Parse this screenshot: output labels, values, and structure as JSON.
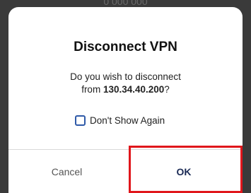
{
  "backdrop": {
    "partial_text": "0 000 000"
  },
  "dialog": {
    "title": "Disconnect VPN",
    "message_line1": "Do you wish to disconnect",
    "message_from": "from ",
    "ip_address": "130.34.40.200",
    "message_end": "?",
    "checkbox_label": "Don't Show Again",
    "checkbox_checked": false,
    "cancel_label": "Cancel",
    "ok_label": "OK"
  },
  "colors": {
    "ok_text": "#1a2a55",
    "checkbox_border": "#2f5aa8",
    "highlight_box": "#e0161b"
  }
}
